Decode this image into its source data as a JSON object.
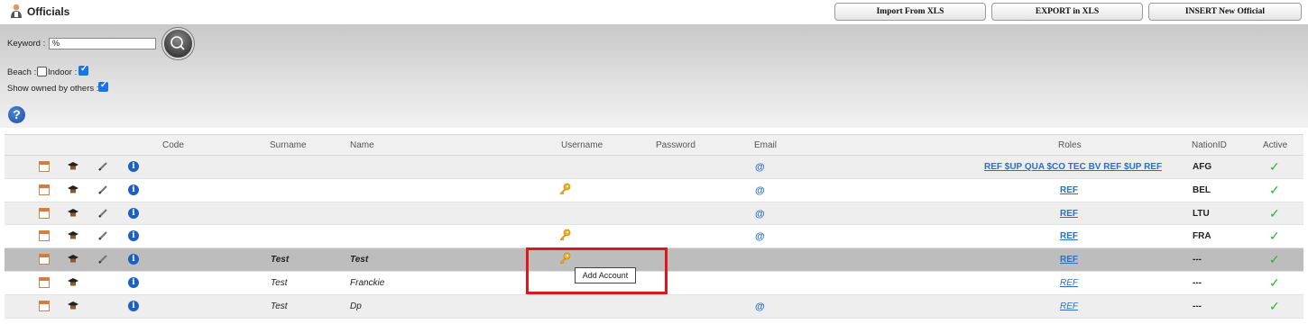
{
  "header": {
    "title": "Officials",
    "buttons": [
      "Import From XLS",
      "EXPORT in XLS",
      "INSERT New Official"
    ]
  },
  "filters": {
    "keyword_label": "Keyword :",
    "keyword_value": "%",
    "beach_label": "Beach :",
    "beach_checked": false,
    "indoor_label": "Indoor :",
    "indoor_checked": true,
    "owned_label": "Show owned by others :",
    "owned_checked": true,
    "help_glyph": "?"
  },
  "columns": {
    "code": "Code",
    "surname": "Surname",
    "name": "Name",
    "username": "Username",
    "password": "Password",
    "email": "Email",
    "roles": "Roles",
    "nation": "NationID",
    "active": "Active"
  },
  "rows": [
    {
      "surname": "",
      "name": "",
      "has_key": false,
      "email": "@",
      "roles": "REF $UP QUA $CO TEC BV REF $UP REF",
      "nation": "AFG",
      "active": "✓",
      "edit": true
    },
    {
      "surname": "",
      "name": "",
      "has_key": true,
      "email": "@",
      "roles": "REF",
      "nation": "BEL",
      "active": "✓",
      "edit": true
    },
    {
      "surname": "",
      "name": "",
      "has_key": false,
      "email": "@",
      "roles": "REF",
      "nation": "LTU",
      "active": "✓",
      "edit": true
    },
    {
      "surname": "",
      "name": "",
      "has_key": true,
      "email": "@",
      "roles": "REF",
      "nation": "FRA",
      "active": "✓",
      "edit": true
    },
    {
      "surname": "Test",
      "name": "Test",
      "has_key": true,
      "email": "",
      "roles": "REF",
      "nation": "---",
      "active": "✓",
      "edit": true
    },
    {
      "surname": "Test",
      "name": "Franckie",
      "has_key": false,
      "email": "",
      "roles": "REF",
      "nation": "---",
      "active": "✓",
      "edit": false
    },
    {
      "surname": "Test",
      "name": "Dp",
      "has_key": false,
      "email": "@",
      "roles": "REF",
      "nation": "---",
      "active": "✓",
      "edit": false
    }
  ],
  "tooltip": "Add Account",
  "colors": {
    "accent": "#2b6fcc",
    "check": "#2bb52b",
    "highlight": "#e0161b"
  }
}
